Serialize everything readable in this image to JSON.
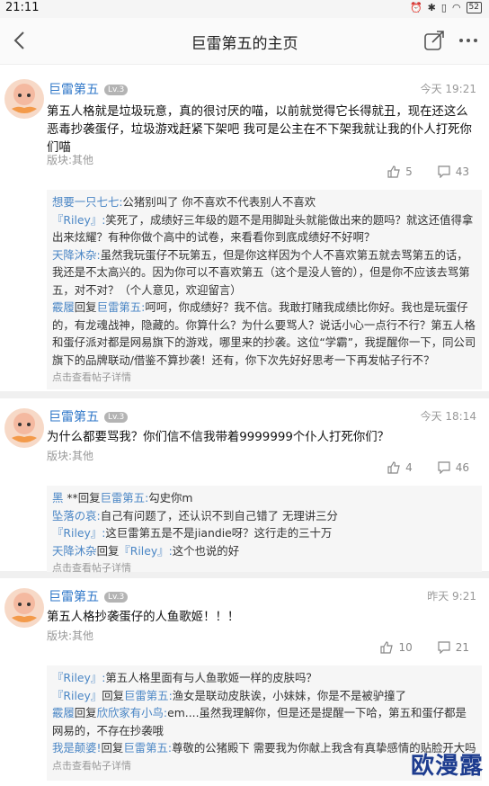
{
  "status": {
    "time": "21:11",
    "battery": "52"
  },
  "header": {
    "title": "巨雷第五的主页"
  },
  "posts": [
    {
      "user": "巨雷第五",
      "level": "Lv.3",
      "time": "今天 19:21",
      "text": "第五人格就是垃圾玩意，真的很讨厌的喵，以前就觉得它长得就丑，现在还这么恶毒抄袭蛋仔，垃圾游戏赶紧下架吧 我可是公主在不下架我就让我的仆人打死你们喵",
      "board": "版块:其他",
      "likes": "5",
      "comments": "43",
      "replies": [
        {
          "name": "想要一只七七:",
          "text": "公猪别叫了 你不喜欢不代表别人不喜欢"
        },
        {
          "name": "『Riley』:",
          "text": "笑死了，成绩好三年级的题不是用脚趾头就能做出来的题吗？就这还值得拿出来炫耀？有种你做个高中的试卷，来看看你到底成绩好不好啊？"
        },
        {
          "name": "天降沐杂:",
          "text": "虽然我玩蛋仔不玩第五，但是你这样因为个人不喜欢第五就去骂第五的话，我还是不太高兴的。因为你可以不喜欢第五（这个是没人管的），但是你不应该去骂第五，对不对？（个人意见，欢迎留言）"
        },
        {
          "name": "霰履",
          "mid": "回复",
          "name2": "巨雷第五:",
          "text": "呵呵，你成绩好？我不信。我敢打赌我成绩比你好。我也是玩蛋仔的，有龙魂战神，隐藏的。你算什么？为什么要骂人？说话小心一点行不行？第五人格和蛋仔派对都是网易旗下的游戏，哪里来的抄袭。这位“学霸”，我提醒你一下，同公司旗下的品牌联动/借鉴不算抄袭！还有，你下次先好好思考一下再发帖子行不？"
        }
      ],
      "more": "点击查看帖子详情"
    },
    {
      "user": "巨雷第五",
      "level": "Lv.3",
      "time": "今天 18:14",
      "text": "为什么都要骂我？你们信不信我带着9999999个仆人打死你们？",
      "board": "版块:其他",
      "likes": "4",
      "comments": "46",
      "replies": [
        {
          "name": "黑",
          "mid": "**回复",
          "name2": "巨雷第五:",
          "text": "勾史你m"
        },
        {
          "name": "坠落の哀:",
          "text": "自己有问题了，还认识不到自己错了 无理讲三分"
        },
        {
          "name": "『Riley』:",
          "text": "这巨雷第五是不是jiandie呀？这行走的三十万"
        },
        {
          "name": "天降沐杂",
          "mid": "回复",
          "name2": "『Riley』:",
          "text": "这个也说的好"
        }
      ],
      "more": "点击查看帖子详情"
    },
    {
      "user": "巨雷第五",
      "level": "Lv.3",
      "time": "昨天 9:21",
      "text": "第五人格抄袭蛋仔的人鱼歌姬！！！",
      "board": "版块:其他",
      "likes": "10",
      "comments": "21",
      "replies": [
        {
          "name": "『Riley』:",
          "text": "第五人格里面有与人鱼歌姬一样的皮肤吗？"
        },
        {
          "name": "『Riley』",
          "mid": "回复",
          "name2": "巨雷第五:",
          "text": "渔女是联动皮肤诶，小妹妹，你是不是被驴撞了"
        },
        {
          "name": "霰履",
          "mid": "回复",
          "name2": "欣欣家有小鸟:",
          "text": "em....虽然我理解你，但是还是提醒一下哈，第五和蛋仔都是网易的，不存在抄袭哦"
        },
        {
          "name": "我是颠婆!",
          "mid": "回复",
          "name2": "巨雷第五:",
          "text": "尊敬的公猪殿下 需要我为你献上我含有真挚感情的贴脸开大吗"
        }
      ],
      "more": "点击查看帖子详情"
    }
  ],
  "watermark": "欧漫露"
}
